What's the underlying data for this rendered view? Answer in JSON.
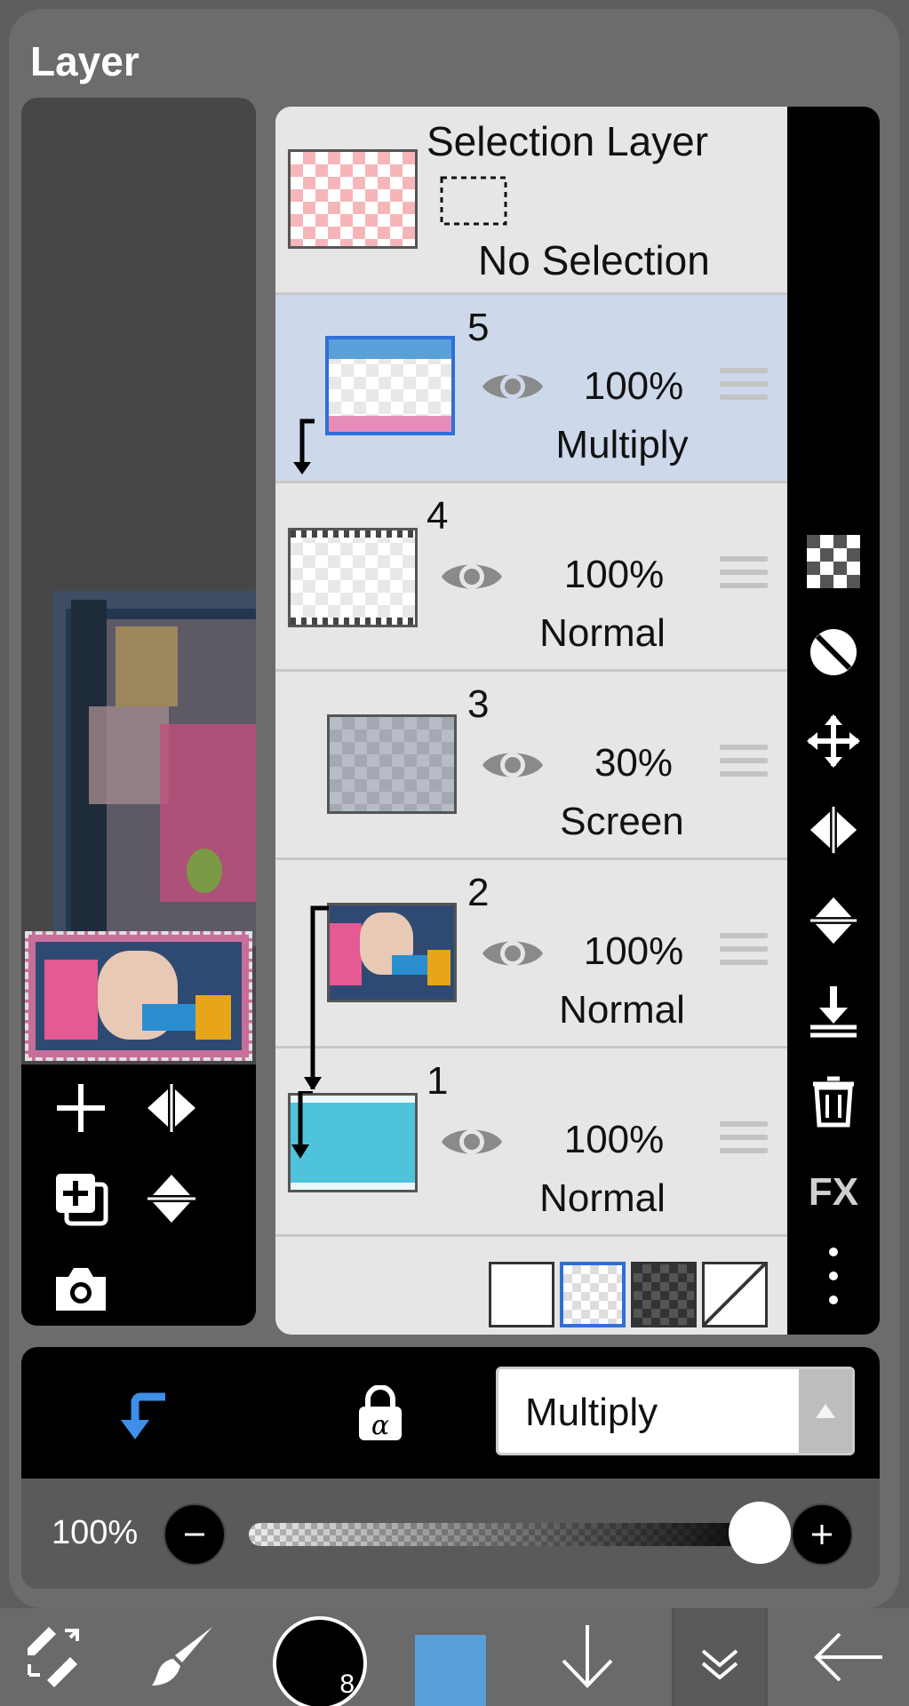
{
  "dialog": {
    "title": "Layer"
  },
  "selection_layer": {
    "title": "Selection Layer",
    "status": "No Selection"
  },
  "layers": [
    {
      "number": "5",
      "opacity": "100%",
      "mode": "Multiply",
      "selected": true,
      "clipped": true
    },
    {
      "number": "4",
      "opacity": "100%",
      "mode": "Normal",
      "selected": false,
      "clipped": false
    },
    {
      "number": "3",
      "opacity": "30%",
      "mode": "Screen",
      "selected": false,
      "clipped": true
    },
    {
      "number": "2",
      "opacity": "100%",
      "mode": "Normal",
      "selected": false,
      "clipped": true
    },
    {
      "number": "1",
      "opacity": "100%",
      "mode": "Normal",
      "selected": false,
      "clipped": false
    }
  ],
  "right_toolbar": {
    "fx_label": "FX"
  },
  "blend": {
    "current_mode": "Multiply"
  },
  "opacity_slider": {
    "value_label": "100%",
    "value": 1.0
  },
  "brush": {
    "size_label": "8"
  },
  "colors": {
    "accent_blue": "#3f8ee8",
    "selected_row": "#cdd8ea",
    "current_color": "#5aa0d8",
    "layer1_fill": "#4fc3dc"
  }
}
